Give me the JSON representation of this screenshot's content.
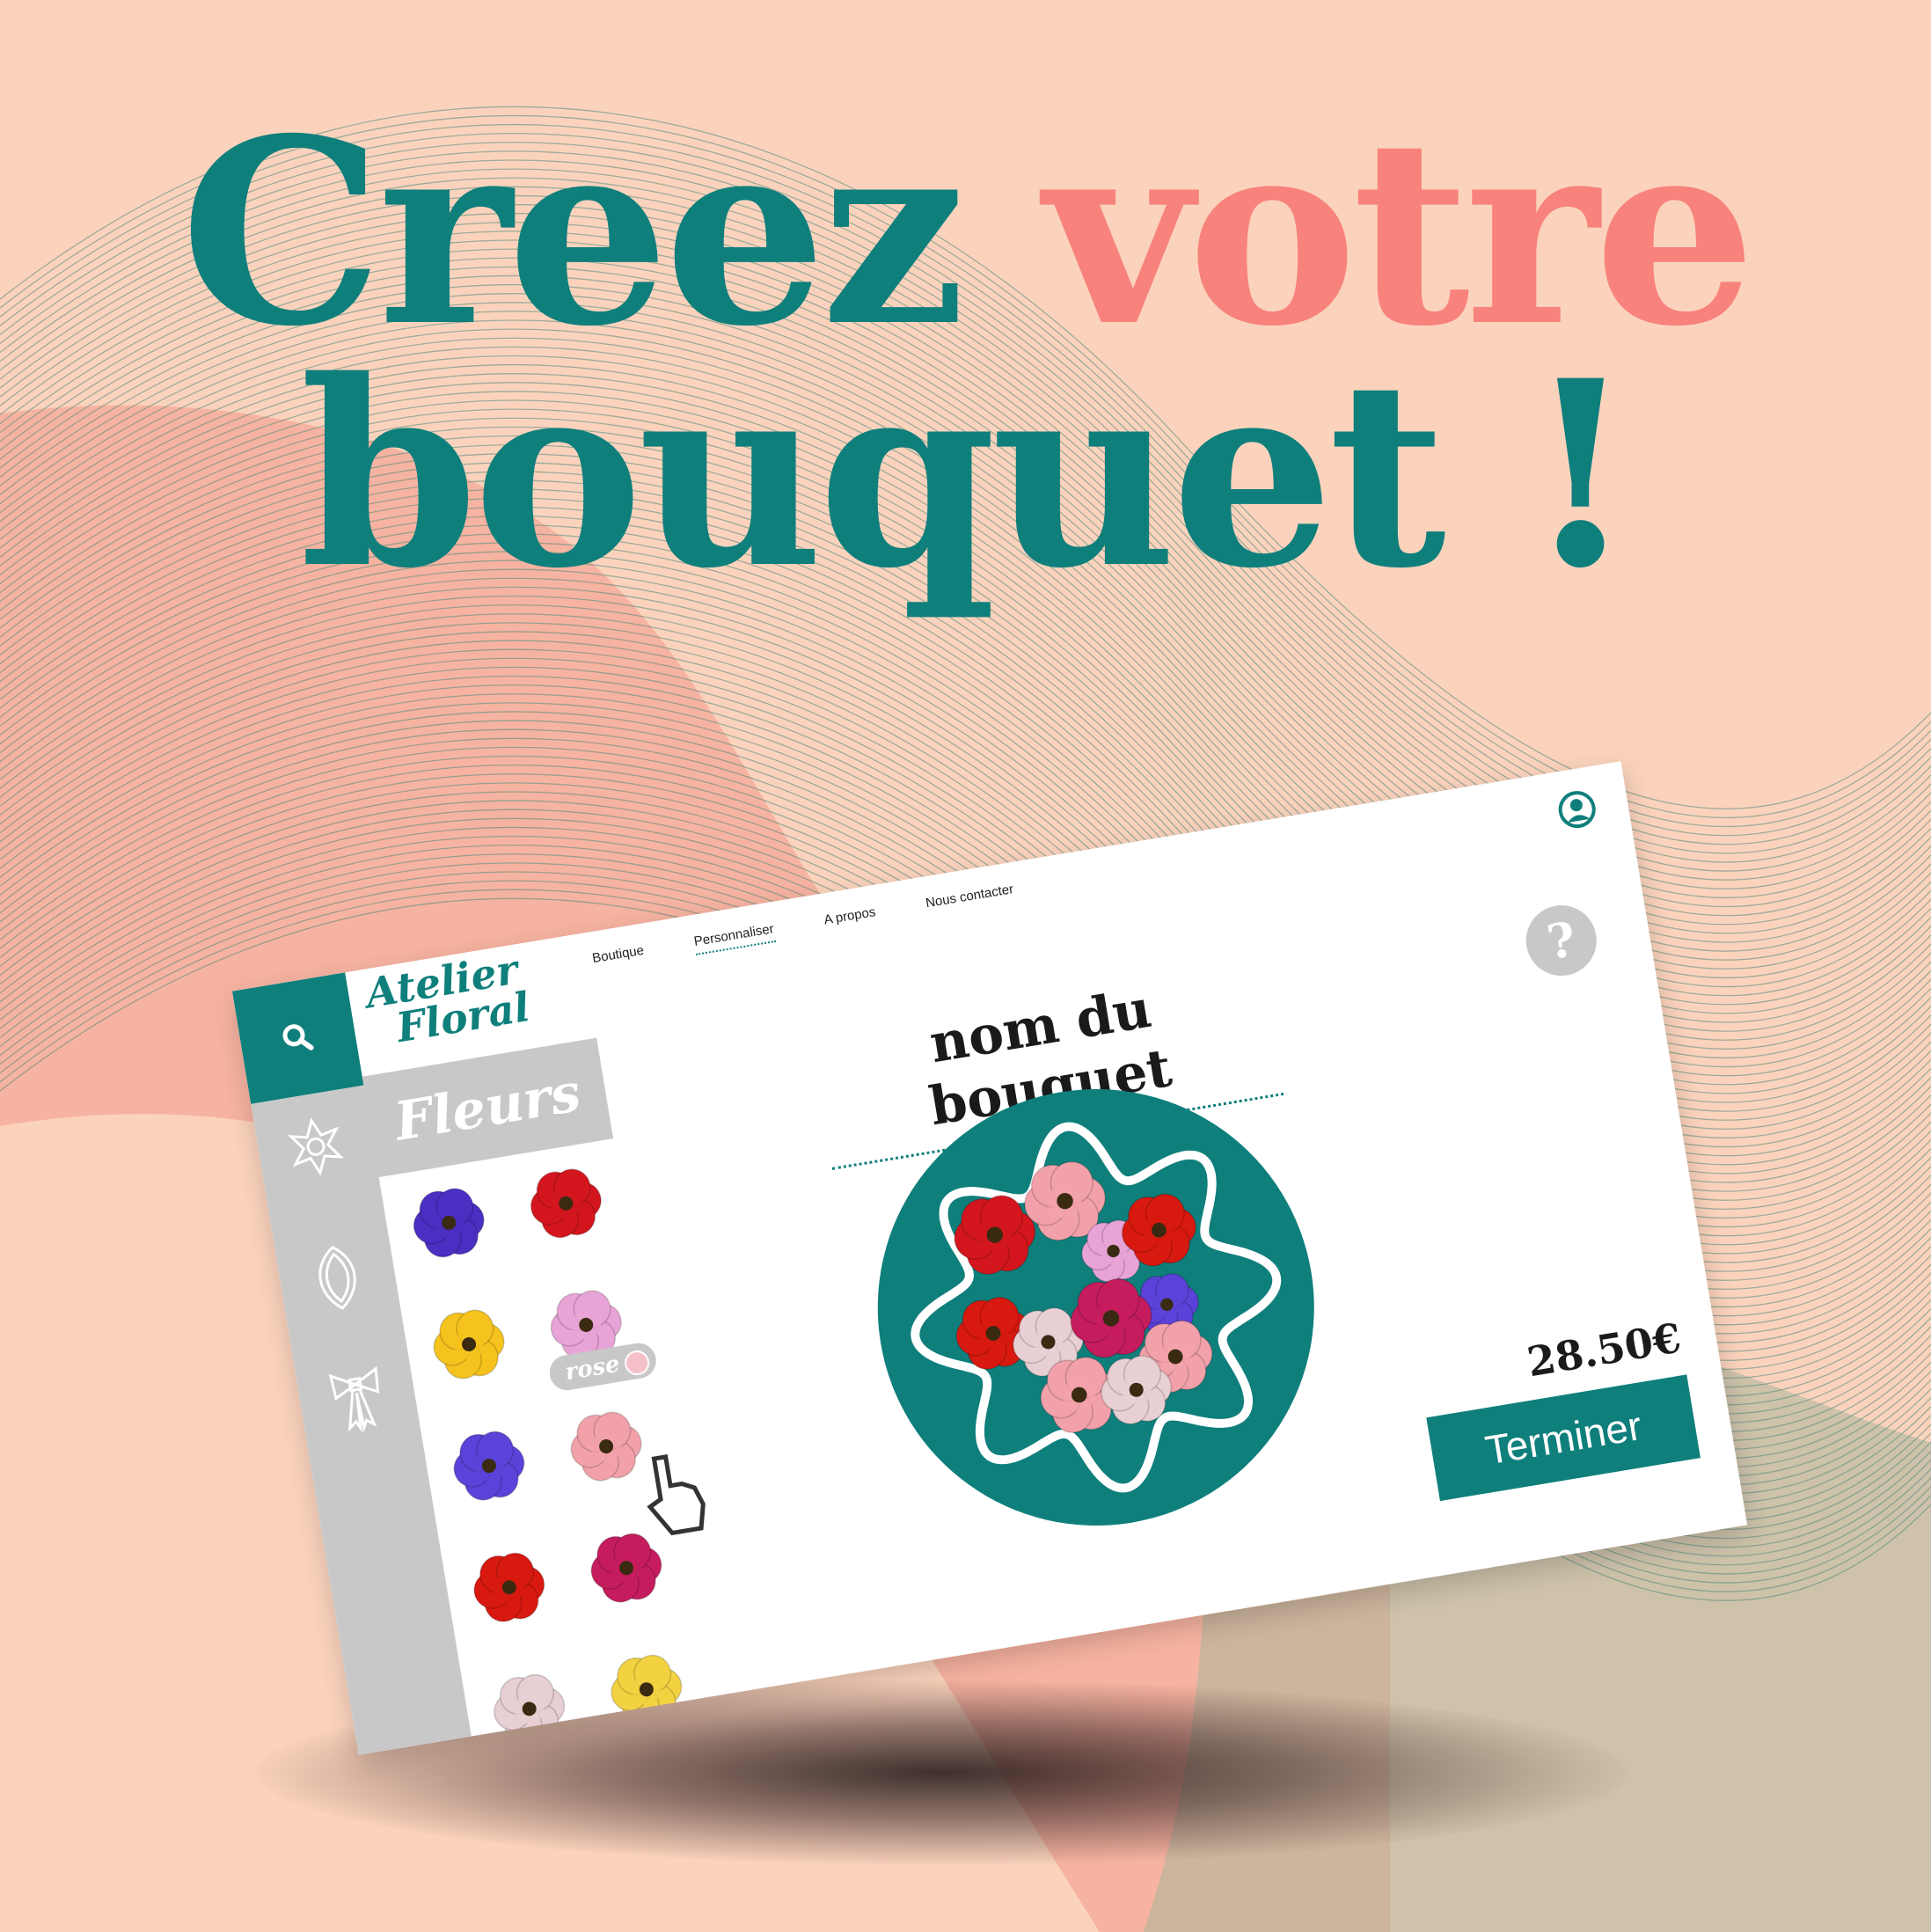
{
  "headline": {
    "line1_word1": "Creez",
    "line1_word2": "votre",
    "line2": "bouquet !"
  },
  "colors": {
    "teal": "#0f7f7c",
    "coral": "#f8827c",
    "peach": "#fbd3bd",
    "gray": "#c8c8c8"
  },
  "app": {
    "logo": {
      "line1": "Atelier",
      "line2": "Floral"
    },
    "nav": [
      "Boutique",
      "Personnaliser",
      "A propos",
      "Nous contacter"
    ],
    "active_nav": "Personnaliser",
    "icons": {
      "search": "search-icon",
      "account": "user-circle-icon",
      "help": "question-icon"
    },
    "sidebar": {
      "tab_label": "Fleurs",
      "rail_icons": [
        "flower-outline-icon",
        "leaf-outline-icon",
        "ribbon-bow-icon"
      ]
    },
    "palette": [
      {
        "name": "anemone",
        "color": "#4b2ec2"
      },
      {
        "name": "poppy",
        "color": "#d3161e"
      },
      {
        "name": "daisy",
        "color": "#f6c21d"
      },
      {
        "name": "anemone-pink",
        "color": "#e8a4d6"
      },
      {
        "name": "violet",
        "color": "#5b42d8"
      },
      {
        "name": "rose",
        "color": "#f2a1aa"
      },
      {
        "name": "red-rose",
        "color": "#d8190f"
      },
      {
        "name": "tulip-magenta",
        "color": "#c51c5d"
      },
      {
        "name": "tulip-white",
        "color": "#e8cfd4"
      },
      {
        "name": "primrose",
        "color": "#f3d241"
      }
    ],
    "tooltip": {
      "label": "rose"
    },
    "bouquet_name": "nom du bouquet",
    "help_label": "?",
    "price": "28.50€",
    "finish_label": "Terminer"
  }
}
